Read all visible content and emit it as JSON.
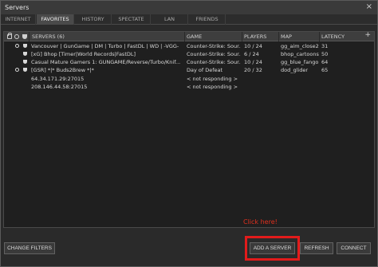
{
  "window": {
    "title": "Servers",
    "close_glyph": "×"
  },
  "tabs": [
    {
      "label": "INTERNET",
      "active": false
    },
    {
      "label": "FAVORITES",
      "active": true
    },
    {
      "label": "HISTORY",
      "active": false
    },
    {
      "label": "SPECTATE",
      "active": false
    },
    {
      "label": "LAN",
      "active": false
    },
    {
      "label": "FRIENDS",
      "active": false
    }
  ],
  "columns": {
    "servers": "SERVERS (6)",
    "game": "GAME",
    "players": "PLAYERS",
    "map": "MAP",
    "latency": "LATENCY",
    "add_glyph": "+"
  },
  "header_icons": [
    "lock-icon",
    "vac-icon",
    "shield-icon"
  ],
  "rows": [
    {
      "vac": true,
      "shield": true,
      "name": "Vancouver | GunGame | DM | Turbo | FastDL | WD | -VGG-",
      "game": "Counter-Strike: Sour...",
      "players": "10 / 24",
      "map": "gg_aim_close2",
      "latency": "31"
    },
    {
      "vac": false,
      "shield": true,
      "name": "[xG] Bhop [Timer|World Records|FastDL]",
      "game": "Counter-Strike: Sour...",
      "players": "6 / 24",
      "map": "bhop_cartoons",
      "latency": "50"
    },
    {
      "vac": false,
      "shield": true,
      "name": "Casual Mature Gamers 1: GUNGAME/Reverse/Turbo/Knif...",
      "game": "Counter-Strike: Sour...",
      "players": "10 / 24",
      "map": "gg_blue_fango",
      "latency": "64"
    },
    {
      "vac": true,
      "shield": true,
      "name": "[GSR] *|* Buds2Brew *|*",
      "game": "Day of Defeat",
      "players": "20 / 32",
      "map": "dod_glider",
      "latency": "65"
    },
    {
      "vac": false,
      "shield": false,
      "name": "64.34.171.29:27015",
      "game": "< not responding >",
      "players": "",
      "map": "",
      "latency": ""
    },
    {
      "vac": false,
      "shield": false,
      "name": "208.146.44.58:27015",
      "game": "< not responding >",
      "players": "",
      "map": "",
      "latency": ""
    }
  ],
  "annotation": {
    "text": "Click here!",
    "color": "#e21b1b"
  },
  "buttons": {
    "change_filters": "CHANGE FILTERS",
    "add_server": "ADD A SERVER",
    "refresh": "REFRESH",
    "connect": "CONNECT"
  }
}
